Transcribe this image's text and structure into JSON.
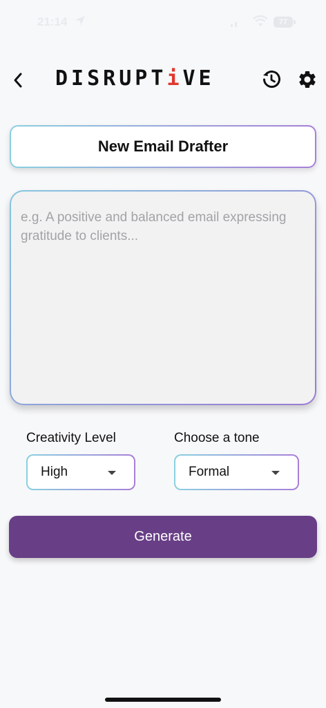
{
  "status_bar": {
    "time": "21:14",
    "battery": "77"
  },
  "header": {
    "back_icon": "chevron-left-icon",
    "logo_parts": [
      "DISRUPT",
      "i",
      "VE"
    ],
    "history_icon": "history-icon",
    "settings_icon": "gear-icon"
  },
  "title_card": {
    "label": "New Email Drafter"
  },
  "prompt": {
    "value": "",
    "placeholder": "e.g. A positive and balanced email expressing gratitude to clients..."
  },
  "creativity": {
    "label": "Creativity Level",
    "selected": "High"
  },
  "tone": {
    "label": "Choose a tone",
    "selected": "Formal"
  },
  "generate": {
    "label": "Generate"
  },
  "colors": {
    "accent": "#683e86",
    "logo_accent": "#e0372f",
    "border_start": "#8ad0e0",
    "border_end": "#a77ed8"
  }
}
